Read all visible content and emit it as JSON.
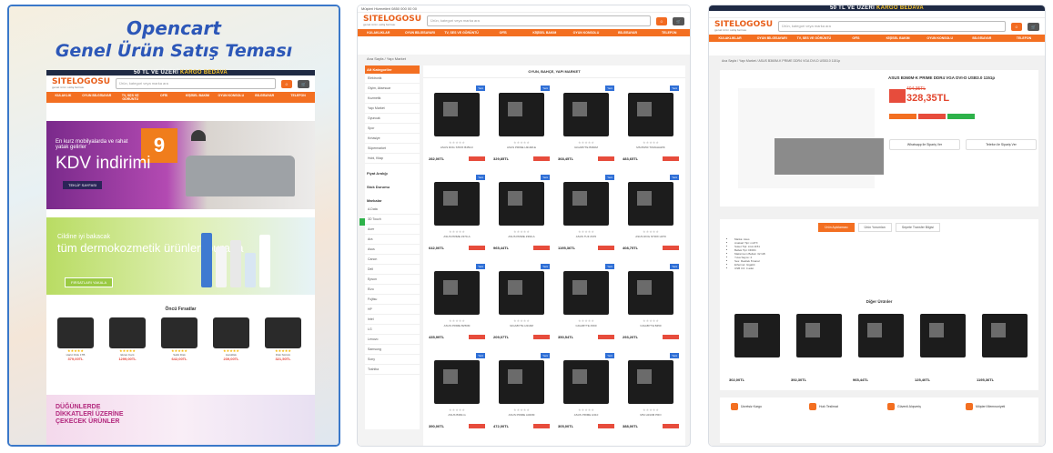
{
  "card1": {
    "title_line1": "Opencart",
    "title_line2": "Genel Ürün Satış Teması",
    "promo_prefix": "50 TL VE ÜZERİ",
    "promo_highlight": "KARGO BEDAVA",
    "logo": "SITELOGOSU",
    "logo_sub": "genel ürün satış teması",
    "search_placeholder": "Ürün, kategori veya marka ara",
    "nav": [
      "KULAKLIK",
      "OYUN BİLGİSAYAR",
      "TV, SES VE GÖRÜNTÜ",
      "OFİS",
      "KİŞİSEL BAKIM",
      "OYUN KONSOLU",
      "BİLGİSAYAR",
      "TELEFON"
    ],
    "kdv_small": "En kurz mobilyalarda ve rahat yatak gelirler",
    "kdv_big": "KDV indirimi",
    "kdv_cta": "TEKLİF SAYFASI",
    "nine": "9",
    "derm_small": "Cildine iyi bakacak",
    "derm_big": "tüm dermokozmetik ürünleri burada",
    "derm_cta": "FIRSATLARI YAKALA",
    "section_title": "Öncü Fırsatlar",
    "products": [
      {
        "name": "Harici Disk 1TB",
        "price": "379,00TL"
      },
      {
        "name": "Ekran Kartı",
        "price": "1299,00TL"
      },
      {
        "name": "Sabit Disk",
        "price": "642,00TL"
      },
      {
        "name": "Harddisk",
        "price": "239,00TL"
      },
      {
        "name": "Disk Sürücü",
        "price": "321,50TL"
      }
    ],
    "dug_title": "DÜĞÜNLERDE DİKKATLERİ ÜZERİNE ÇEKECEK ÜRÜNLER"
  },
  "card2": {
    "promo": "Müşteri Hizmetleri 0850 000 00 00",
    "logo": "SITELOGOSU",
    "logo_sub": "genel ürün satış teması",
    "search_placeholder": "Ürün, kategori veya marka ara",
    "nav": [
      "KULAKLIKLAR",
      "OYUN BİLGİSAYARI",
      "TV, SES VE GÖRÜNTÜ",
      "OFİS",
      "KİŞİSEL BAKIM",
      "OYUN KONSOLU",
      "BİLGİSAYAR",
      "TELEFON"
    ],
    "breadcrumb": "Ana Sayfa / Yapı Market",
    "sidebar_title": "Alt Kategoriler",
    "sidebar_items": [
      "Elektronik",
      "Giyim, Aksesuar",
      "Kozmetik",
      "Yapı Market",
      "Oyuncak",
      "Spor",
      "Kırtasiye",
      "Süpermarket",
      "Hobi, Kitap"
    ],
    "filter_price": "Fiyat Aralığı",
    "filter_stock": "Stok Durumu",
    "filter_brands": "Markalar",
    "brands": [
      "A.Data",
      "3D Touch",
      "Acer",
      "Ara",
      "Asus",
      "Canon",
      "Dell",
      "Epson",
      "Eizo",
      "Fujitsu",
      "HP",
      "Intel",
      "LG",
      "Lenovo",
      "Samsung",
      "Sony",
      "Toshiba"
    ],
    "grid_title": "OYUN, BAHÇE, YAPI MARKET",
    "products": [
      {
        "name": "ASUS ROG STRIX B450-F",
        "price": "282,00TL"
      },
      {
        "name": "ASUS PRIME H310M-E",
        "price": "329,85TL"
      },
      {
        "name": "GIGABYTE B360M",
        "price": "368,45TL"
      },
      {
        "name": "MSI B450 TOMAHAWK",
        "price": "483,65TL"
      },
      {
        "name": "ASUS PRIME Z370-A",
        "price": "642,00TL"
      },
      {
        "name": "ASUS PRIME Z390-A",
        "price": "965,44TL"
      },
      {
        "name": "ASUS TUF Z370",
        "price": "1195,36TL"
      },
      {
        "name": "ASUS ROG STRIX H370",
        "price": "408,75TL"
      },
      {
        "name": "ASUS PRIME B250M",
        "price": "435,99TL"
      },
      {
        "name": "GIGABYTE H310M",
        "price": "209,07TL"
      },
      {
        "name": "GIGABYTE Z390",
        "price": "350,54TL"
      },
      {
        "name": "GIGABYTE B450",
        "price": "293,20TL"
      },
      {
        "name": "ASUS B360-G",
        "price": "390,00TL"
      },
      {
        "name": "ASUS PRIME A320M",
        "price": "472,00TL"
      },
      {
        "name": "ASUS PRIME H310",
        "price": "305,00TL"
      },
      {
        "name": "MSI H310M PRO",
        "price": "388,00TL"
      }
    ]
  },
  "card3": {
    "promo_prefix": "50 TL VE ÜZERİ",
    "promo_highlight": "KARGO BEDAVA",
    "logo": "SITELOGOSU",
    "logo_sub": "genel ürün satış teması",
    "search_placeholder": "Ürün, kategori veya marka ara",
    "nav": [
      "KULAKLIKLAR",
      "OYUN BİLGİSAYARI",
      "TV, SES VE GÖRÜNTÜ",
      "OFİS",
      "KİŞİSEL BAKIM",
      "OYUN KONSOLU",
      "BİLGİSAYAR",
      "TELEFON"
    ],
    "breadcrumb": "Ana Sayfa / Yapı Market / ASUS B360M-K PRIME DDR4 VGA DVI-D USB3.0 1151p",
    "product_title": "ASUS B360M-K PRIME DDR4 VGA DVI-D USB3.0 1151p",
    "old_price": "404,35TL",
    "price": "328,35TL",
    "tabs": [
      "Ürün Açıklaması",
      "Ürün Yorumları",
      "Sepete Transfer Bilgisi"
    ],
    "specs": [
      "Marka: Asus",
      "Anakart Tipi: mATX",
      "Soket Tipi: LGA 1151",
      "Bellek Tipi: DDR4",
      "Maksimum Bellek: 32 GB",
      "Yuva Sayısı: 2",
      "Ses: Realtek 8 kanal",
      "Ethernet: Gigabit",
      "USB 3.0: 4 adet"
    ],
    "similar_title": "Diğer Ürünler",
    "similar": [
      {
        "price": "302,00TL"
      },
      {
        "price": "392,30TL"
      },
      {
        "price": "965,44TL"
      },
      {
        "price": "125,40TL"
      },
      {
        "price": "1195,36TL"
      }
    ],
    "features": [
      "Ücretsiz Kargo",
      "Hızlı Teslimat",
      "Güvenli Alışveriş",
      "Müşteri Memnuniyeti"
    ],
    "whatsapp_a": "Whatsapp ile Sipariş Ver",
    "whatsapp_b": "Telefon ile Sipariş Ver"
  },
  "colors": {
    "accent": "#f36f21",
    "title_blue": "#2c57b8",
    "price_red": "#e2462e",
    "navy": "#1f2a44"
  }
}
